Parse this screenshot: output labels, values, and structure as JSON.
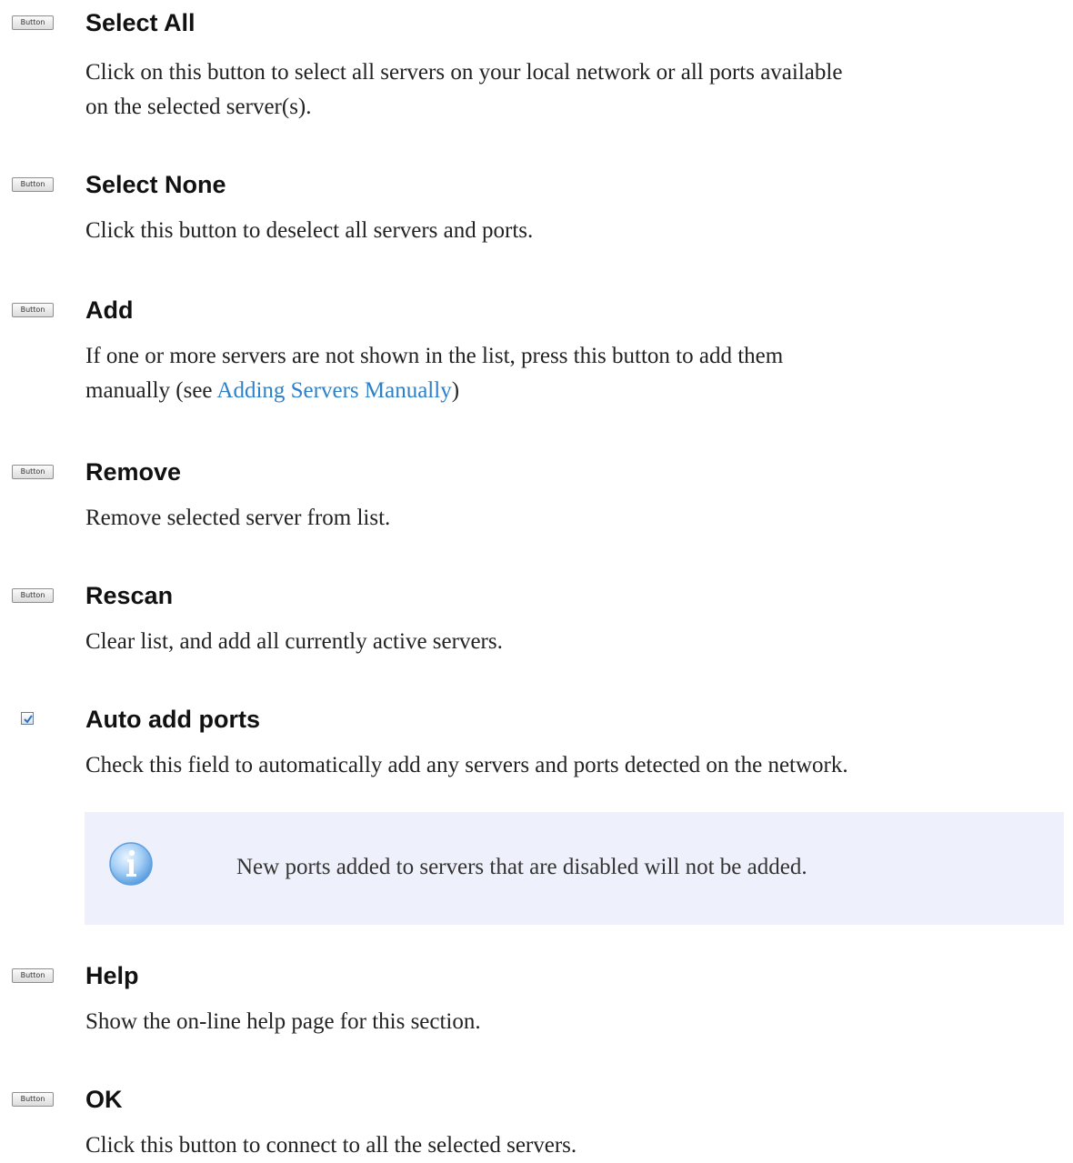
{
  "button_icon_label": "Button",
  "entries": [
    {
      "title": "Select All",
      "desc_l1": "Click on this button to select all servers on your local network or all ports available",
      "desc_l2": "on the selected server(s)."
    },
    {
      "title": "Select None",
      "desc": "Click this button to deselect all servers and ports."
    },
    {
      "title": "Add",
      "desc_l1": "If one or more servers are not shown in the list, press this button to add them",
      "desc_pre": "manually (see ",
      "link": "Adding Servers Manually",
      "desc_post": ")"
    },
    {
      "title": "Remove",
      "desc": "Remove selected server from list."
    },
    {
      "title": "Rescan",
      "desc": "Clear list, and add all currently active servers."
    },
    {
      "title": "Auto add ports",
      "desc": "Check this field to automatically add any servers and ports detected on the network.",
      "checked": true
    },
    {
      "title": "Help",
      "desc": "Show the on-line help page for this section."
    },
    {
      "title": "OK",
      "desc": "Click this button to connect to all the selected servers."
    }
  ],
  "note": {
    "text": "New ports added to servers that are disabled will not be added.",
    "icon": "info-icon"
  },
  "colors": {
    "link": "#2e80c8",
    "note_background": "#eef0fb",
    "info_icon": "#6fb0ea"
  }
}
